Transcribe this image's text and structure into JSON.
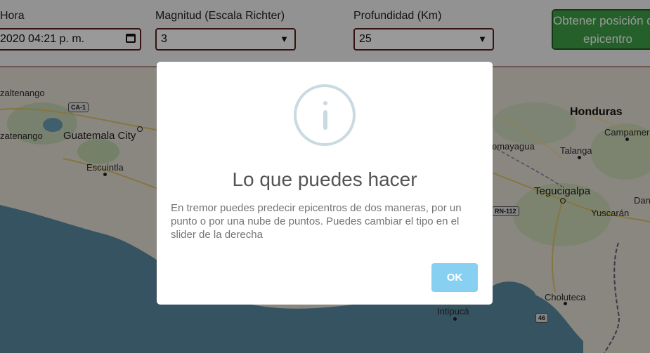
{
  "controls": {
    "hora_label": "Hora",
    "hora_value": "2020 04:21 p. m.",
    "magnitud_label": "Magnitud (Escala Richter)",
    "magnitud_value": "3",
    "profundidad_label": "Profundidad (Km)",
    "profundidad_value": "25",
    "obtain_label": "Obtener posición del epicentro"
  },
  "map": {
    "labels": {
      "quetzaltenango": "zaltenango",
      "suchitepequez": "zatenango",
      "guatemala_city": "Guatemala City",
      "escuintla": "Escuintla",
      "honduras": "Honduras",
      "comayagua": "omayagua",
      "talanga": "Talanga",
      "campamento": "Campamer",
      "tegucigalpa": "Tegucigalpa",
      "yuscaran": "Yuscarán",
      "danli": "Dan",
      "choluteca": "Choluteca",
      "intipuca": "Intipucá"
    },
    "shields": {
      "ca1": "CA-1",
      "rn112": "RN-112",
      "r46": "46"
    }
  },
  "modal": {
    "title": "Lo que puedes hacer",
    "text": "En tremor puedes predecir epicentros de dos maneras, por un punto o por una nube de puntos. Puedes cambiar el tipo en el slider de la derecha",
    "ok_label": "OK",
    "icon": "info-icon"
  }
}
